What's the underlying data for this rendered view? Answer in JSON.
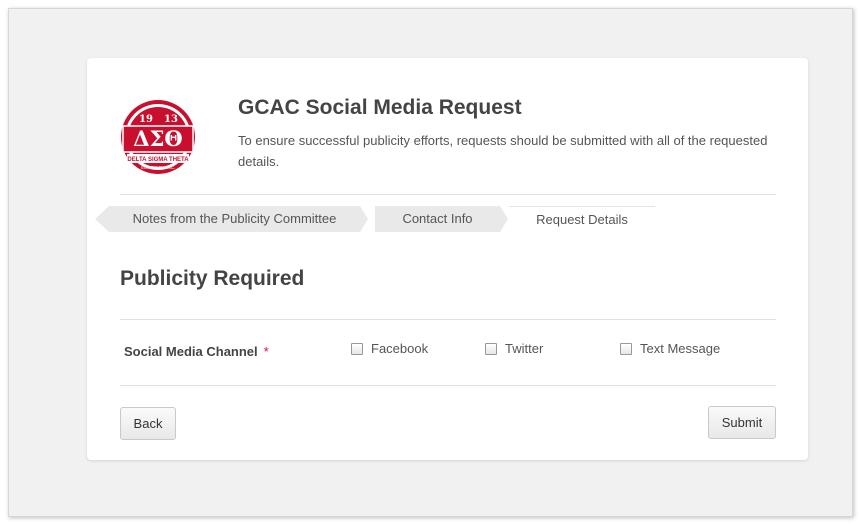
{
  "header": {
    "title": "GCAC Social Media Request",
    "description": "To ensure successful publicity efforts, requests should be submitted with all of the requested details.",
    "logo_text": {
      "year_left": "19",
      "year_right": "13",
      "letters": "ΔΣΘ",
      "ribbon": "DELTA SIGMA THETA",
      "sub": "SORORITY, INC."
    }
  },
  "tabs": [
    {
      "label": "Notes from the Publicity Committee",
      "state": "done"
    },
    {
      "label": "Contact Info",
      "state": "done"
    },
    {
      "label": "Request Details",
      "state": "active"
    }
  ],
  "section": {
    "title": "Publicity Required"
  },
  "field": {
    "label": "Social Media Channel",
    "required_mark": "*",
    "options": [
      "Facebook",
      "Twitter",
      "Text Message"
    ]
  },
  "buttons": {
    "back": "Back",
    "submit": "Submit"
  },
  "colors": {
    "brand_red": "#c8102e",
    "text": "#444444",
    "tab_done_bg": "#e9e9e9"
  }
}
